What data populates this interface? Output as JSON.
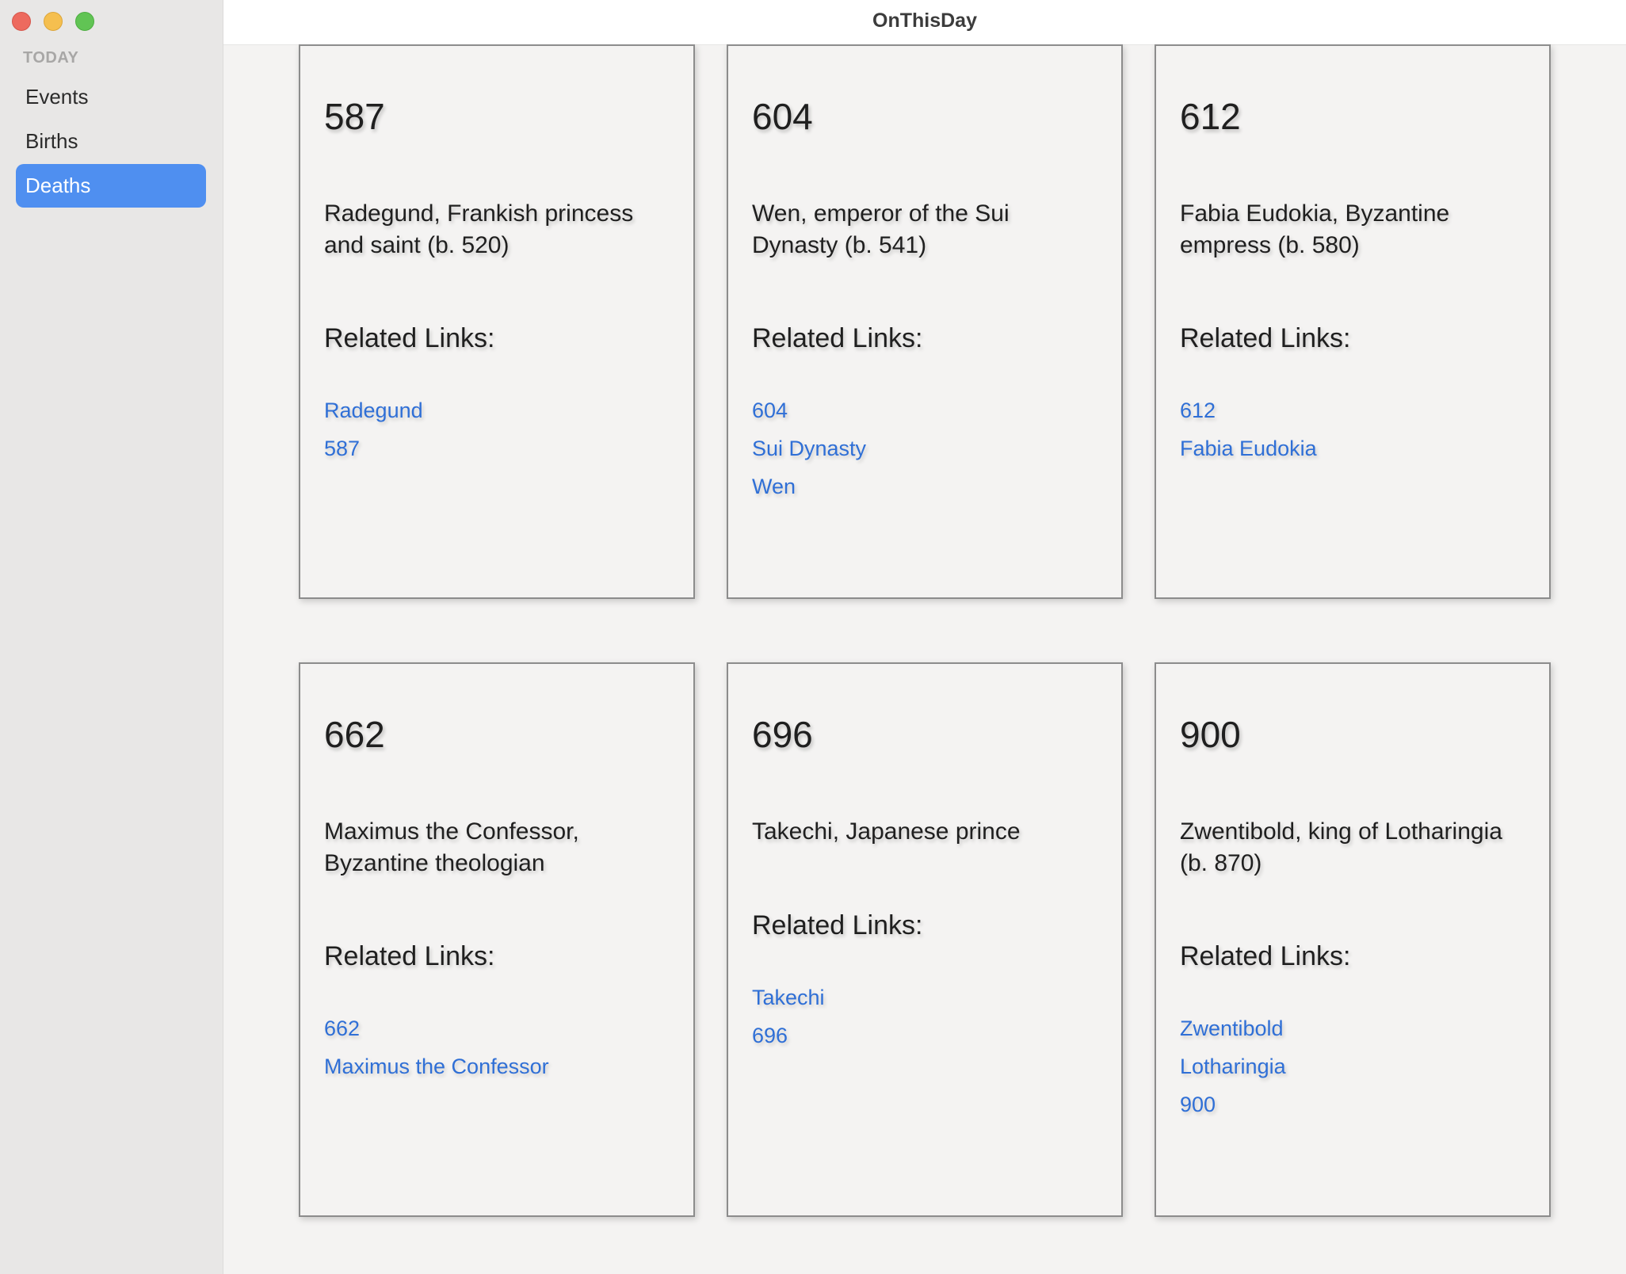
{
  "window": {
    "title": "OnThisDay"
  },
  "sidebar": {
    "section_header": "TODAY",
    "items": [
      {
        "label": "Events"
      },
      {
        "label": "Births"
      },
      {
        "label": "Deaths"
      }
    ],
    "selected": "Deaths"
  },
  "colors": {
    "accent": "#4f8ff0",
    "link": "#2f6fd6",
    "sidebar_bg": "#e8e7e6",
    "content_bg": "#f4f3f2"
  },
  "cards": [
    {
      "year": "587",
      "description": "Radegund, Frankish princess and saint (b. 520)",
      "related_label": "Related Links:",
      "links": [
        "Radegund",
        "587"
      ]
    },
    {
      "year": "604",
      "description": "Wen, emperor of the Sui Dynasty (b. 541)",
      "related_label": "Related Links:",
      "links": [
        "604",
        "Sui Dynasty",
        "Wen"
      ]
    },
    {
      "year": "612",
      "description": "Fabia Eudokia, Byzantine empress (b. 580)",
      "related_label": "Related Links:",
      "links": [
        "612",
        "Fabia Eudokia"
      ]
    },
    {
      "year": "662",
      "description": "Maximus the Confessor, Byzantine theologian",
      "related_label": "Related Links:",
      "links": [
        "662",
        "Maximus the Confessor"
      ]
    },
    {
      "year": "696",
      "description": "Takechi, Japanese prince",
      "related_label": "Related Links:",
      "links": [
        "Takechi",
        "696"
      ]
    },
    {
      "year": "900",
      "description": "Zwentibold, king of Lotharingia (b. 870)",
      "related_label": "Related Links:",
      "links": [
        "Zwentibold",
        "Lotharingia",
        "900"
      ]
    }
  ]
}
